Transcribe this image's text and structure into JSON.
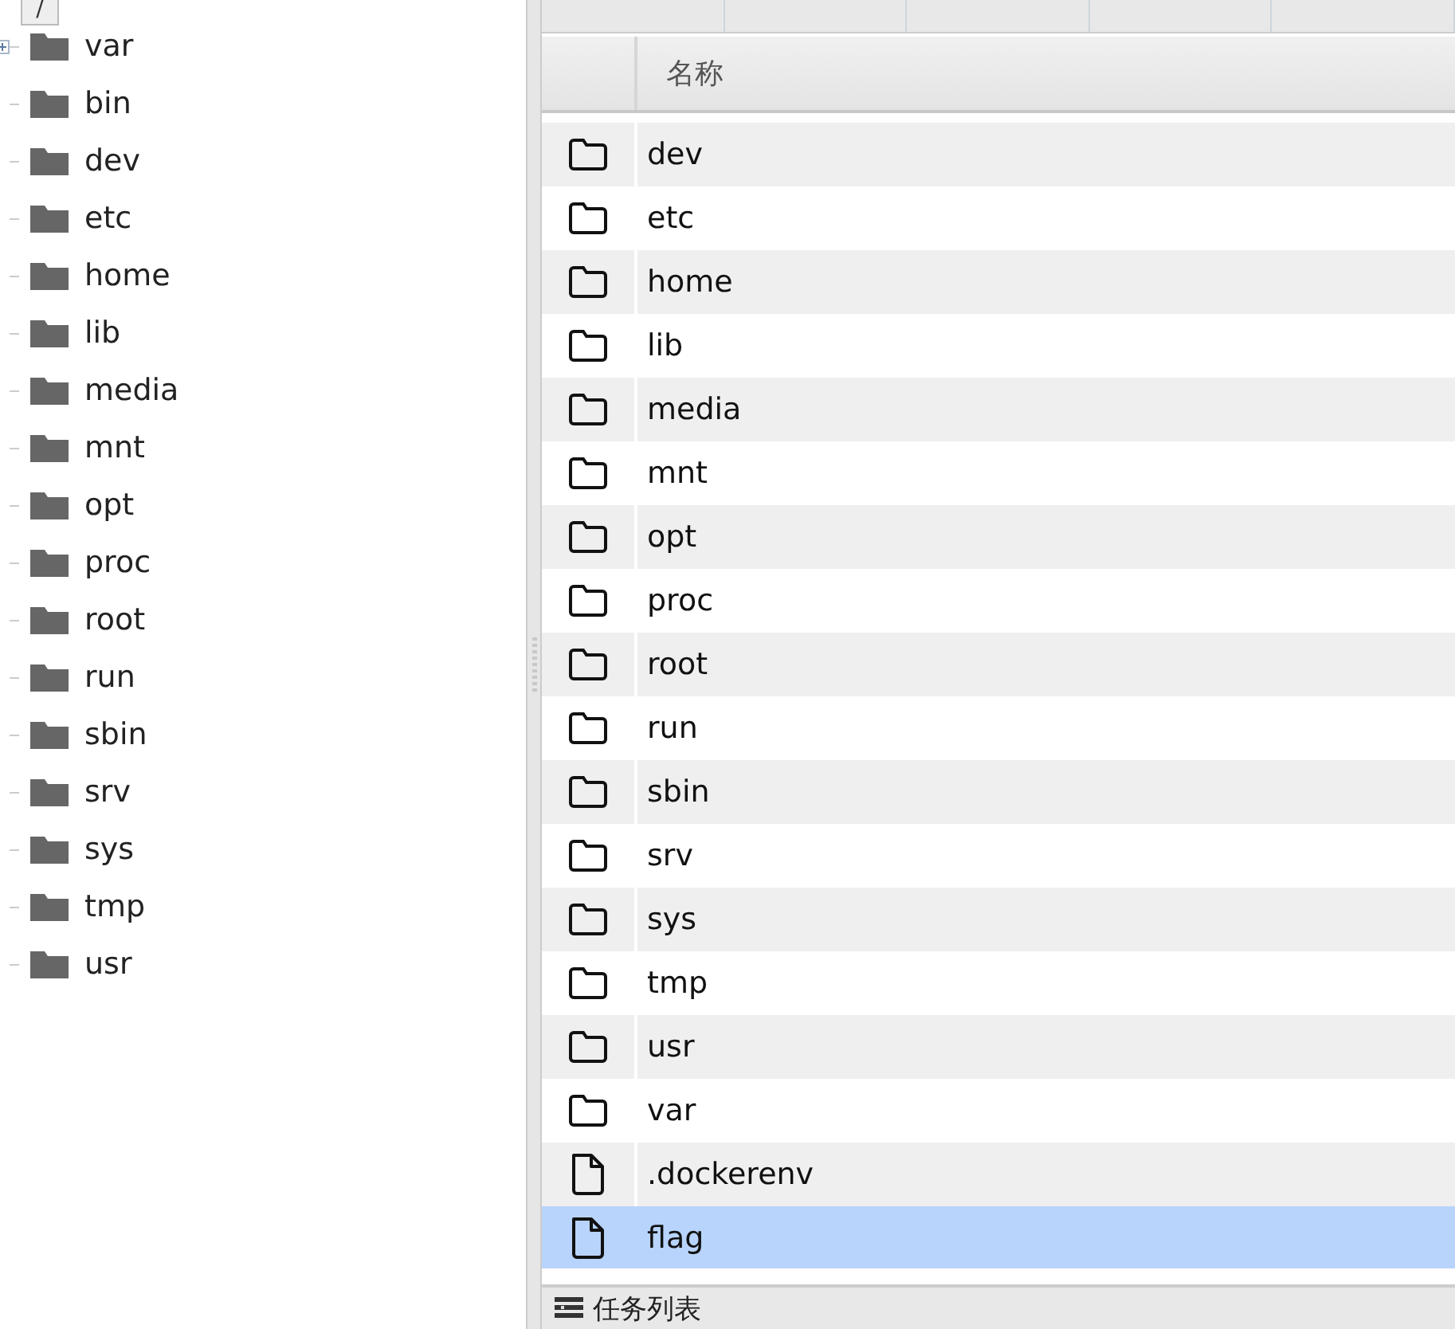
{
  "tree": {
    "root": "/",
    "children": [
      {
        "name": "var",
        "expandable": true
      },
      {
        "name": "bin",
        "expandable": false
      },
      {
        "name": "dev",
        "expandable": false
      },
      {
        "name": "etc",
        "expandable": false
      },
      {
        "name": "home",
        "expandable": false
      },
      {
        "name": "lib",
        "expandable": false
      },
      {
        "name": "media",
        "expandable": false
      },
      {
        "name": "mnt",
        "expandable": false
      },
      {
        "name": "opt",
        "expandable": false
      },
      {
        "name": "proc",
        "expandable": false
      },
      {
        "name": "root",
        "expandable": false
      },
      {
        "name": "run",
        "expandable": false
      },
      {
        "name": "sbin",
        "expandable": false
      },
      {
        "name": "srv",
        "expandable": false
      },
      {
        "name": "sys",
        "expandable": false
      },
      {
        "name": "tmp",
        "expandable": false
      },
      {
        "name": "usr",
        "expandable": false
      }
    ]
  },
  "table": {
    "columns": [
      "名称"
    ],
    "rows": [
      {
        "name": "dev",
        "kind": "folder",
        "selected": false
      },
      {
        "name": "etc",
        "kind": "folder",
        "selected": false
      },
      {
        "name": "home",
        "kind": "folder",
        "selected": false
      },
      {
        "name": "lib",
        "kind": "folder",
        "selected": false
      },
      {
        "name": "media",
        "kind": "folder",
        "selected": false
      },
      {
        "name": "mnt",
        "kind": "folder",
        "selected": false
      },
      {
        "name": "opt",
        "kind": "folder",
        "selected": false
      },
      {
        "name": "proc",
        "kind": "folder",
        "selected": false
      },
      {
        "name": "root",
        "kind": "folder",
        "selected": false
      },
      {
        "name": "run",
        "kind": "folder",
        "selected": false
      },
      {
        "name": "sbin",
        "kind": "folder",
        "selected": false
      },
      {
        "name": "srv",
        "kind": "folder",
        "selected": false
      },
      {
        "name": "sys",
        "kind": "folder",
        "selected": false
      },
      {
        "name": "tmp",
        "kind": "folder",
        "selected": false
      },
      {
        "name": "usr",
        "kind": "folder",
        "selected": false
      },
      {
        "name": "var",
        "kind": "folder",
        "selected": false
      },
      {
        "name": ".dockerenv",
        "kind": "file",
        "selected": false
      },
      {
        "name": "flag",
        "kind": "file",
        "selected": true
      }
    ]
  },
  "task_panel": {
    "title": "任务列表"
  }
}
